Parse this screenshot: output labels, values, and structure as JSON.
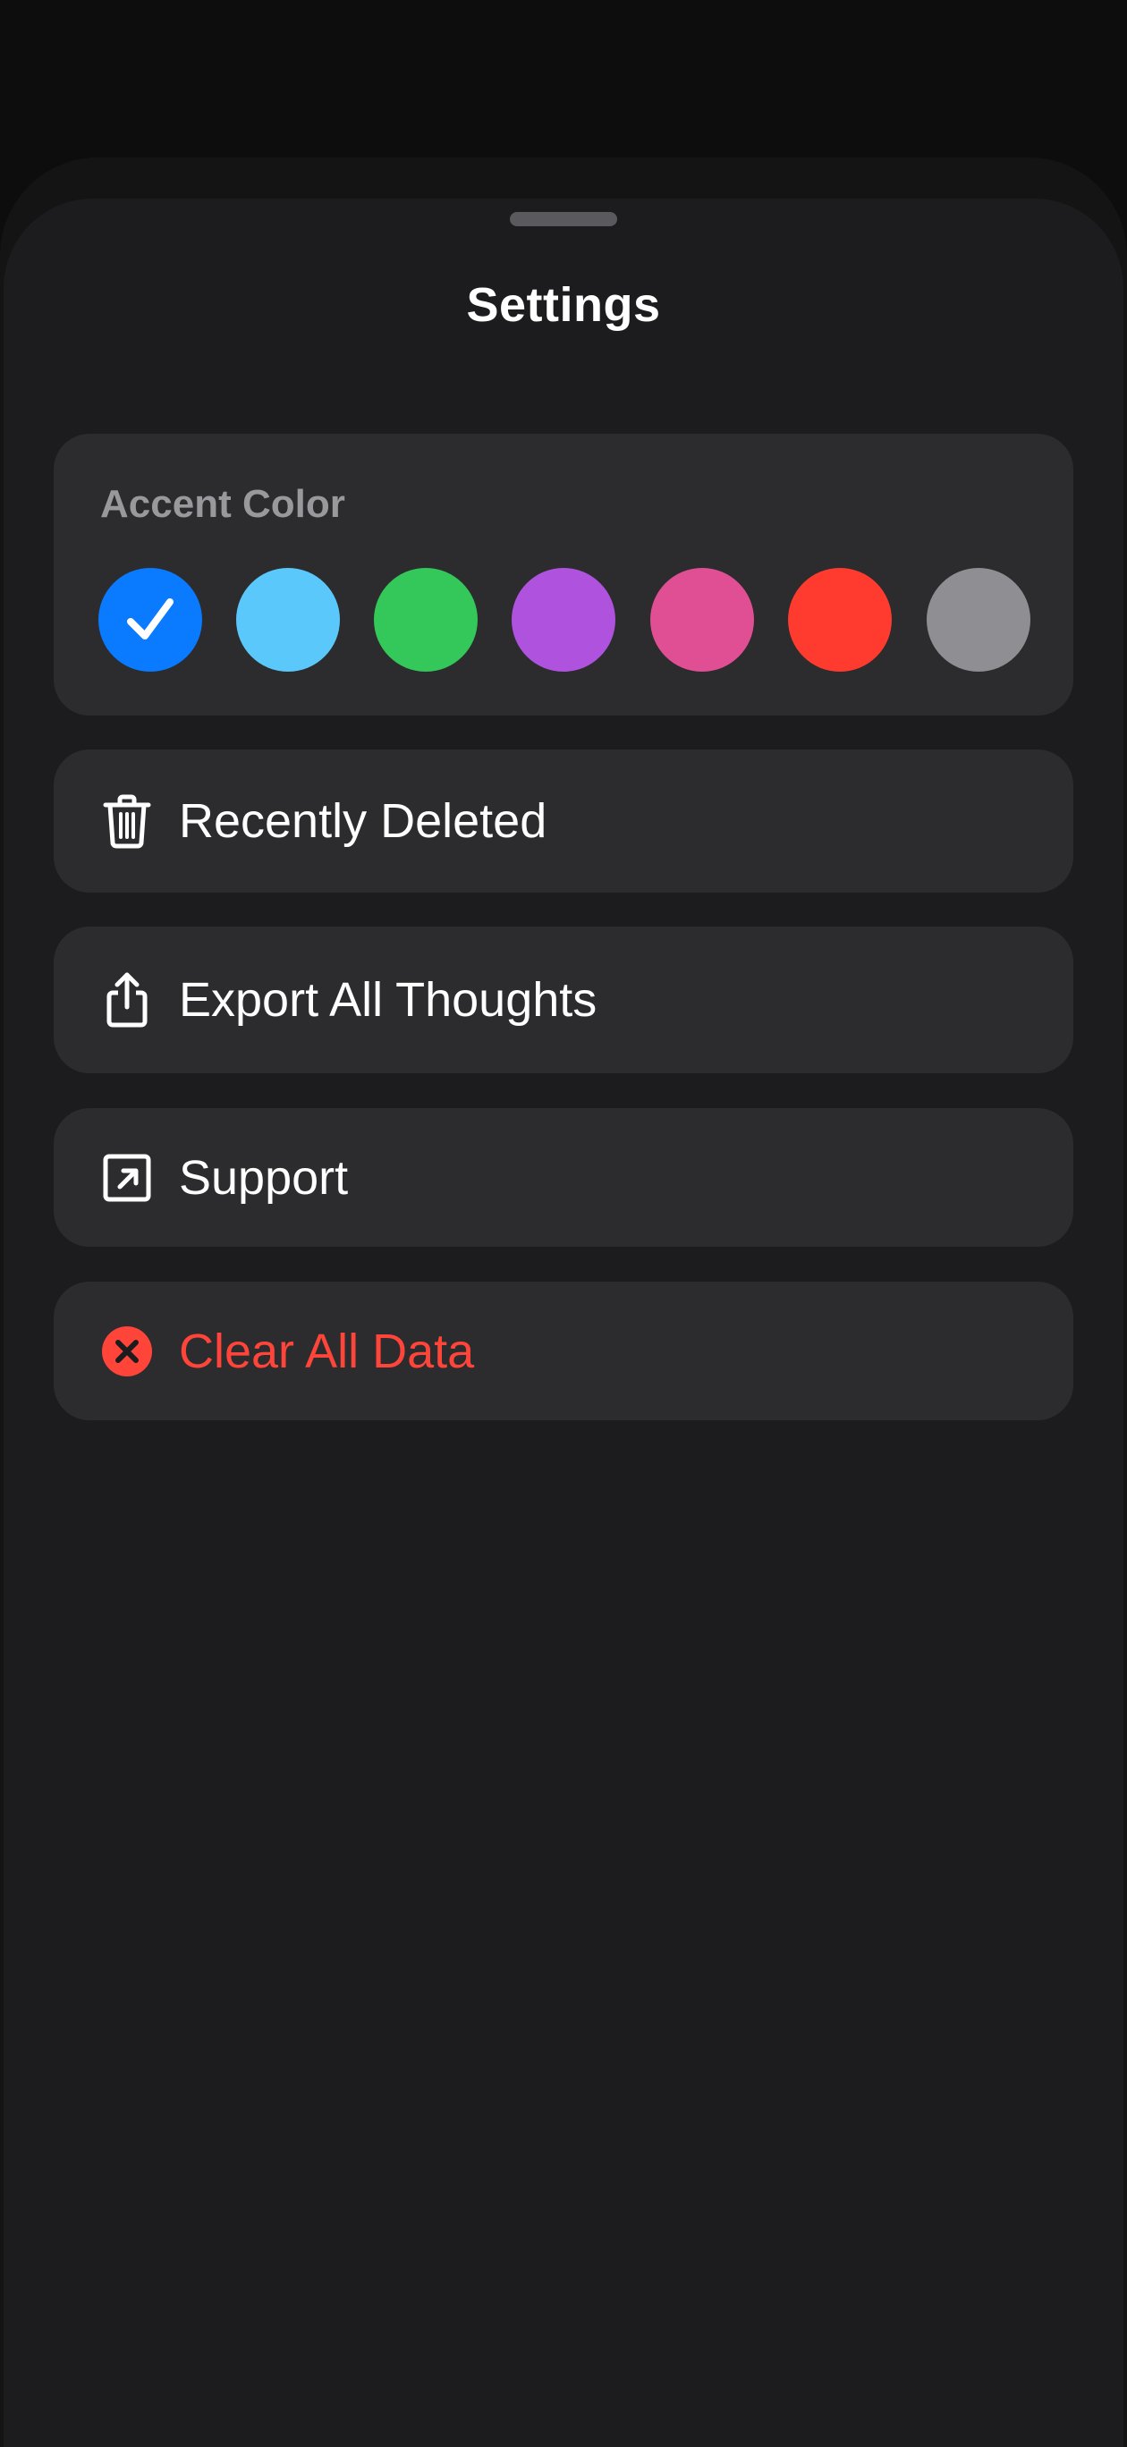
{
  "sheet": {
    "title": "Settings"
  },
  "accent": {
    "label": "Accent Color",
    "selected_index": 0,
    "colors": [
      {
        "name": "blue",
        "hex": "#0a7aff"
      },
      {
        "name": "light-blue",
        "hex": "#5ac8fa"
      },
      {
        "name": "green",
        "hex": "#34c759"
      },
      {
        "name": "purple",
        "hex": "#af52de"
      },
      {
        "name": "pink",
        "hex": "#e04f93"
      },
      {
        "name": "red",
        "hex": "#ff3b30"
      },
      {
        "name": "gray",
        "hex": "#8e8e93"
      }
    ]
  },
  "rows": [
    {
      "label": "Recently Deleted",
      "icon": "trash-icon",
      "color": "#ffffff"
    },
    {
      "label": "Export All Thoughts",
      "icon": "share-icon",
      "color": "#ffffff"
    },
    {
      "label": "Support",
      "icon": "external-link-icon",
      "color": "#ffffff"
    },
    {
      "label": "Clear All Data",
      "icon": "clear-circle-icon",
      "color": "#ff453a"
    }
  ]
}
